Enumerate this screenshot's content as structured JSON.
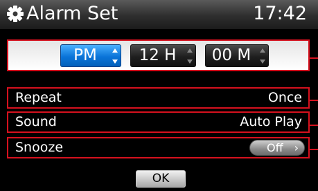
{
  "header": {
    "title": "Alarm Set",
    "clock": "17:42",
    "icon": "gear-icon"
  },
  "time": {
    "ampm": "PM",
    "hour": "12 H",
    "minute": "00 M"
  },
  "options": {
    "repeat": {
      "label": "Repeat",
      "value": "Once"
    },
    "sound": {
      "label": "Sound",
      "value": "Auto Play"
    },
    "snooze": {
      "label": "Snooze",
      "value": "Off",
      "chevron": "›"
    }
  },
  "ok_label": "OK",
  "colors": {
    "highlight_border": "#d6111e",
    "active_spinner": "#0a74d8",
    "background": "#000000"
  }
}
